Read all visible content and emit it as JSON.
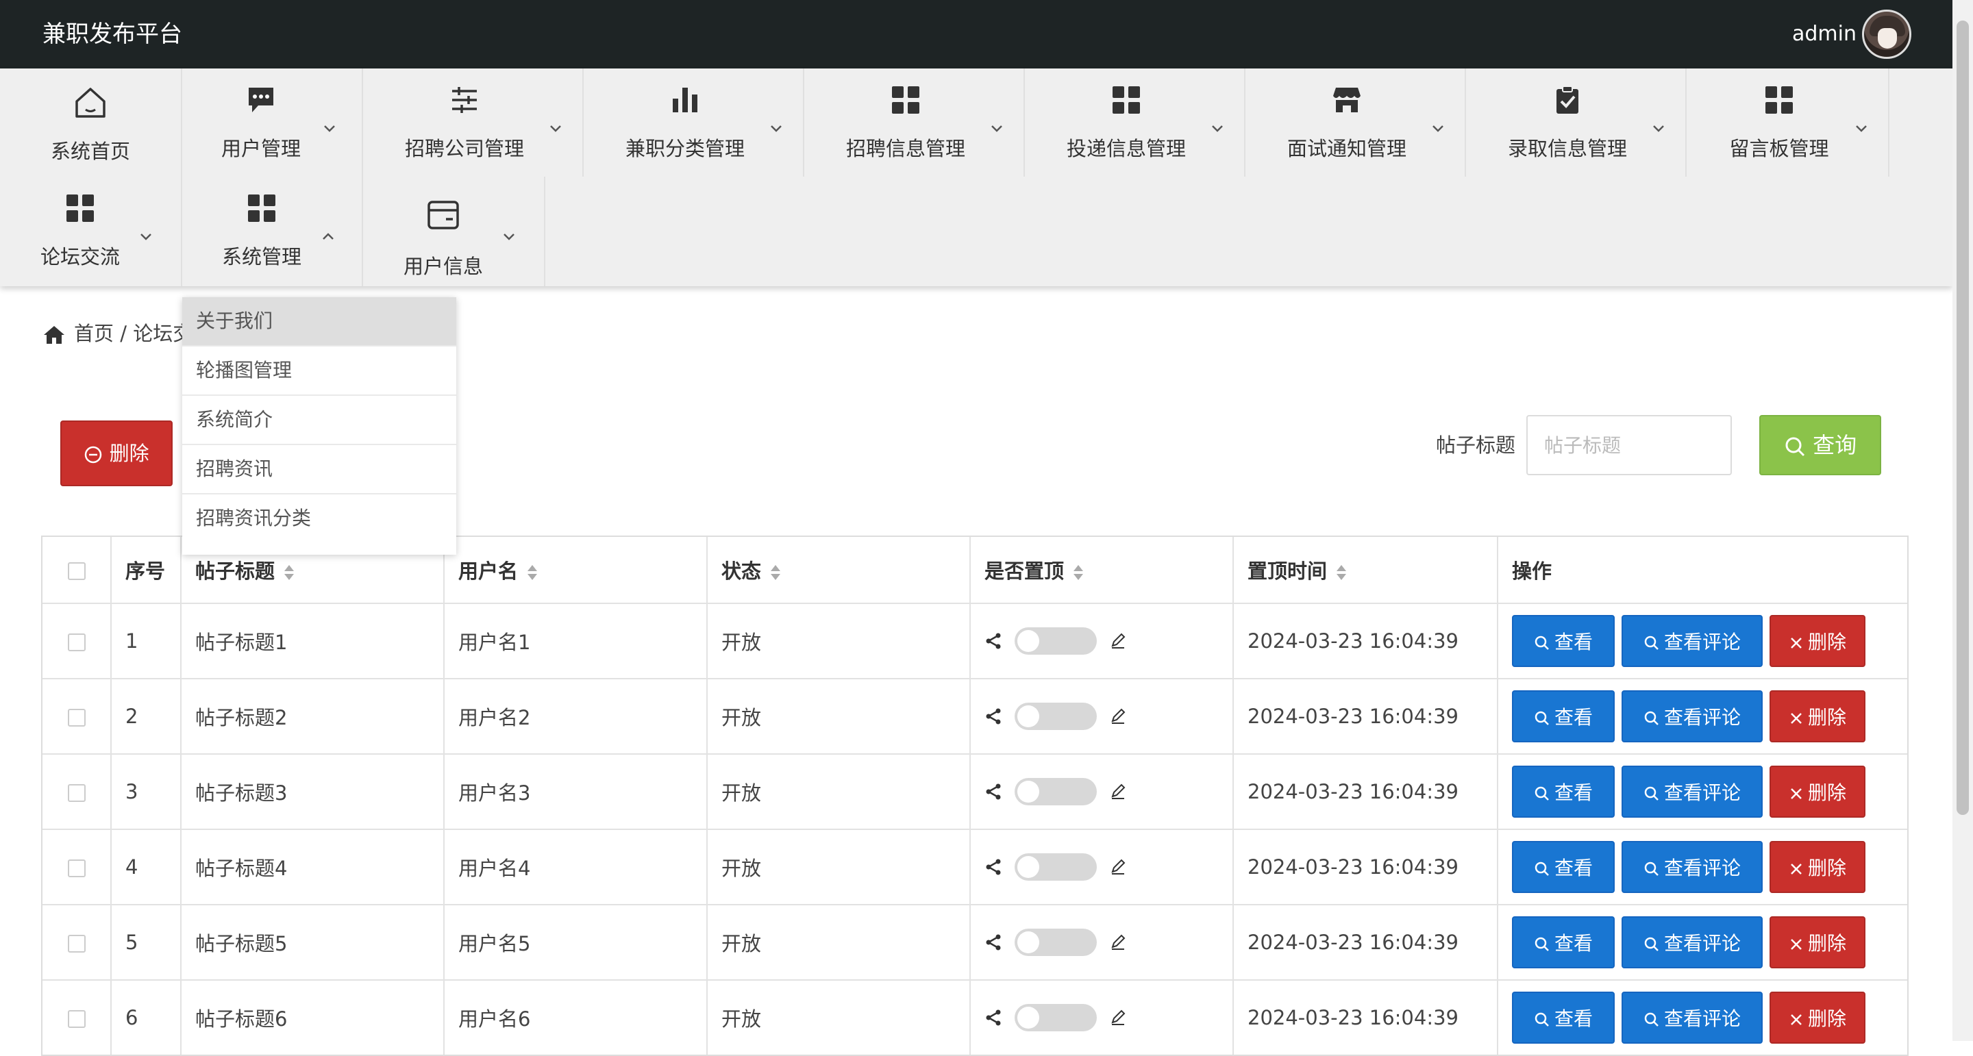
{
  "header": {
    "brand": "兼职发布平台",
    "username": "admin"
  },
  "nav": {
    "items": [
      {
        "label": "系统首页",
        "icon": "home-icon"
      },
      {
        "label": "用户管理",
        "icon": "chat-icon"
      },
      {
        "label": "招聘公司管理",
        "icon": "sliders-icon"
      },
      {
        "label": "兼职分类管理",
        "icon": "bar-chart-icon"
      },
      {
        "label": "招聘信息管理",
        "icon": "grid-icon"
      },
      {
        "label": "投递信息管理",
        "icon": "grid-icon"
      },
      {
        "label": "面试通知管理",
        "icon": "store-icon"
      },
      {
        "label": "录取信息管理",
        "icon": "clipboard-check-icon"
      },
      {
        "label": "留言板管理",
        "icon": "grid-icon"
      },
      {
        "label": "论坛交流",
        "icon": "grid-icon"
      },
      {
        "label": "系统管理",
        "icon": "grid-icon"
      },
      {
        "label": "用户信息",
        "icon": "wallet-icon"
      }
    ],
    "dropdown": [
      "关于我们",
      "轮播图管理",
      "系统简介",
      "招聘资讯",
      "招聘资讯分类"
    ]
  },
  "breadcrumb": {
    "home": "首页",
    "separator": "/",
    "current": "论坛交"
  },
  "toolbar": {
    "delete_label": "删除",
    "search_label": "帖子标题",
    "search_placeholder": "帖子标题",
    "query_label": "查询"
  },
  "table": {
    "headers": [
      "序号",
      "帖子标题",
      "用户名",
      "状态",
      "是否置顶",
      "置顶时间",
      "操作"
    ],
    "actions": {
      "view": "查看",
      "view_comments": "查看评论",
      "delete": "删除"
    },
    "rows": [
      {
        "id": "1",
        "title": "帖子标题1",
        "user": "用户名1",
        "status": "开放",
        "time": "2024-03-23 16:04:39"
      },
      {
        "id": "2",
        "title": "帖子标题2",
        "user": "用户名2",
        "status": "开放",
        "time": "2024-03-23 16:04:39"
      },
      {
        "id": "3",
        "title": "帖子标题3",
        "user": "用户名3",
        "status": "开放",
        "time": "2024-03-23 16:04:39"
      },
      {
        "id": "4",
        "title": "帖子标题4",
        "user": "用户名4",
        "status": "开放",
        "time": "2024-03-23 16:04:39"
      },
      {
        "id": "5",
        "title": "帖子标题5",
        "user": "用户名5",
        "status": "开放",
        "time": "2024-03-23 16:04:39"
      },
      {
        "id": "6",
        "title": "帖子标题6",
        "user": "用户名6",
        "status": "开放",
        "time": "2024-03-23 16:04:39"
      }
    ]
  },
  "colors": {
    "topbar": "#1e2425",
    "danger": "#c9302c",
    "primary": "#1976d2",
    "success": "#8bc34a"
  }
}
